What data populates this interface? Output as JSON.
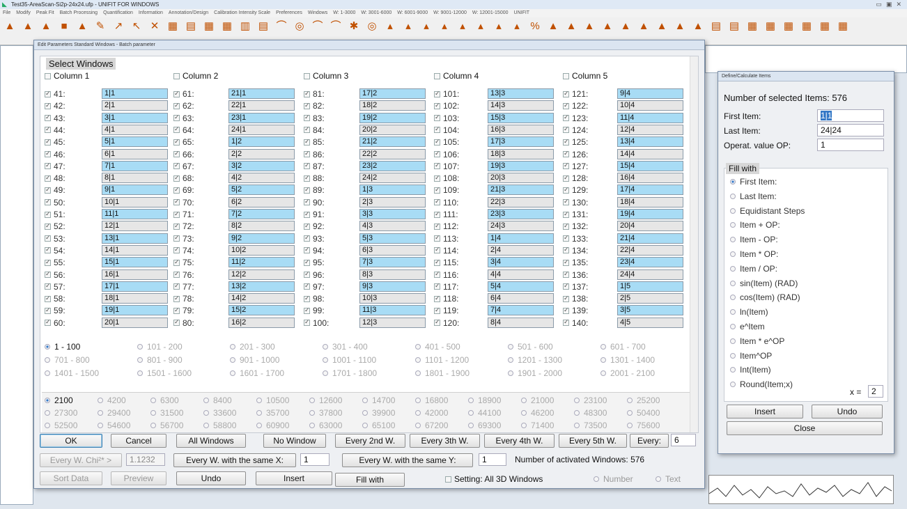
{
  "app": {
    "title": "Test35-AreaScan-Si2p-24x24.ufp - UNIFIT FOR WINDOWS",
    "menu": [
      "File",
      "Modify",
      "Peak Fit",
      "Batch Processing",
      "Quantification",
      "Information",
      "Annotation/Design",
      "Calibration Intensity Scale",
      "Preferences",
      "Windows",
      "W: 1-3000",
      "W: 3001-6000",
      "W: 6001-9000",
      "W: 9001-12000",
      "W: 12001-15000",
      "UNIFIT"
    ]
  },
  "dialog": {
    "title": "Edit Parameters Standard Windows - Batch parameter",
    "section": "Select Windows",
    "columns": [
      "Column 1",
      "Column 2",
      "Column 3",
      "Column 4",
      "Column 5"
    ],
    "rows": [
      [
        "41:",
        "1|1",
        "61:",
        "21|1",
        "81:",
        "17|2",
        "101:",
        "13|3",
        "121:",
        "9|4"
      ],
      [
        "42:",
        "2|1",
        "62:",
        "22|1",
        "82:",
        "18|2",
        "102:",
        "14|3",
        "122:",
        "10|4"
      ],
      [
        "43:",
        "3|1",
        "63:",
        "23|1",
        "83:",
        "19|2",
        "103:",
        "15|3",
        "123:",
        "11|4"
      ],
      [
        "44:",
        "4|1",
        "64:",
        "24|1",
        "84:",
        "20|2",
        "104:",
        "16|3",
        "124:",
        "12|4"
      ],
      [
        "45:",
        "5|1",
        "65:",
        "1|2",
        "85:",
        "21|2",
        "105:",
        "17|3",
        "125:",
        "13|4"
      ],
      [
        "46:",
        "6|1",
        "66:",
        "2|2",
        "86:",
        "22|2",
        "106:",
        "18|3",
        "126:",
        "14|4"
      ],
      [
        "47:",
        "7|1",
        "67:",
        "3|2",
        "87:",
        "23|2",
        "107:",
        "19|3",
        "127:",
        "15|4"
      ],
      [
        "48:",
        "8|1",
        "68:",
        "4|2",
        "88:",
        "24|2",
        "108:",
        "20|3",
        "128:",
        "16|4"
      ],
      [
        "49:",
        "9|1",
        "69:",
        "5|2",
        "89:",
        "1|3",
        "109:",
        "21|3",
        "129:",
        "17|4"
      ],
      [
        "50:",
        "10|1",
        "70:",
        "6|2",
        "90:",
        "2|3",
        "110:",
        "22|3",
        "130:",
        "18|4"
      ],
      [
        "51:",
        "11|1",
        "71:",
        "7|2",
        "91:",
        "3|3",
        "111:",
        "23|3",
        "131:",
        "19|4"
      ],
      [
        "52:",
        "12|1",
        "72:",
        "8|2",
        "92:",
        "4|3",
        "112:",
        "24|3",
        "132:",
        "20|4"
      ],
      [
        "53:",
        "13|1",
        "73:",
        "9|2",
        "93:",
        "5|3",
        "113:",
        "1|4",
        "133:",
        "21|4"
      ],
      [
        "54:",
        "14|1",
        "74:",
        "10|2",
        "94:",
        "6|3",
        "114:",
        "2|4",
        "134:",
        "22|4"
      ],
      [
        "55:",
        "15|1",
        "75:",
        "11|2",
        "95:",
        "7|3",
        "115:",
        "3|4",
        "135:",
        "23|4"
      ],
      [
        "56:",
        "16|1",
        "76:",
        "12|2",
        "96:",
        "8|3",
        "116:",
        "4|4",
        "136:",
        "24|4"
      ],
      [
        "57:",
        "17|1",
        "77:",
        "13|2",
        "97:",
        "9|3",
        "117:",
        "5|4",
        "137:",
        "1|5"
      ],
      [
        "58:",
        "18|1",
        "78:",
        "14|2",
        "98:",
        "10|3",
        "118:",
        "6|4",
        "138:",
        "2|5"
      ],
      [
        "59:",
        "19|1",
        "79:",
        "15|2",
        "99:",
        "11|3",
        "119:",
        "7|4",
        "139:",
        "3|5"
      ],
      [
        "60:",
        "20|1",
        "80:",
        "16|2",
        "100:",
        "12|3",
        "120:",
        "8|4",
        "140:",
        "4|5"
      ]
    ],
    "ranges": [
      "1 - 100",
      "101 - 200",
      "201 - 300",
      "301 - 400",
      "401 - 500",
      "501 - 600",
      "601 - 700",
      "701 - 800",
      "801 - 900",
      "901 - 1000",
      "1001 - 1100",
      "1101 - 1200",
      "1201 - 1300",
      "1301 - 1400",
      "1401 - 1500",
      "1501 - 1600",
      "1601 - 1700",
      "1701 - 1800",
      "1801 - 1900",
      "1901 - 2000",
      "2001 - 2100"
    ],
    "pages": [
      "2100",
      "4200",
      "6300",
      "8400",
      "10500",
      "12600",
      "14700",
      "16800",
      "18900",
      "21000",
      "23100",
      "25200",
      "27300",
      "29400",
      "31500",
      "33600",
      "35700",
      "37800",
      "39900",
      "42000",
      "44100",
      "46200",
      "48300",
      "50400",
      "52500",
      "54600",
      "56700",
      "58800",
      "60900",
      "63000",
      "65100",
      "67200",
      "69300",
      "71400",
      "73500",
      "75600"
    ],
    "buttons": {
      "ok": "OK",
      "cancel": "Cancel",
      "all": "All Windows",
      "none": "No Window",
      "every2": "Every 2nd W.",
      "every3": "Every 3th W.",
      "every4": "Every 4th W.",
      "every5": "Every 5th W.",
      "every": "Every:",
      "chi": "Every W. Chi²* >",
      "samex": "Every W. with the same X:",
      "samey": "Every W. with the same Y:",
      "sort": "Sort Data",
      "preview": "Preview",
      "undo": "Undo",
      "insert": "Insert",
      "fill": "Fill with"
    },
    "inputs": {
      "every": "6",
      "chi": "1.1232",
      "samex": "1",
      "samey": "1"
    },
    "activated": "Number of activated Windows: 576",
    "setting3d": "Setting: All 3D Windows",
    "number": "Number",
    "text": "Text"
  },
  "define": {
    "title": "Define/Calculate Items",
    "selected": "Number of selected Items:  576",
    "first_label": "First Item:",
    "first_value": "1|1",
    "last_label": "Last Item:",
    "last_value": "24|24",
    "op_label": "Operat. value OP:",
    "op_value": "1",
    "fill_legend": "Fill with",
    "options": [
      "First Item:",
      "Last Item:",
      "Equidistant Steps",
      "Item + OP:",
      "Item - OP:",
      "Item * OP:",
      "Item / OP:",
      "sin(Item) (RAD)",
      "cos(Item) (RAD)",
      "ln(Item)",
      "e^Item",
      "Item * e^OP",
      "Item^OP",
      "Int(Item)",
      "Round(Item;x)"
    ],
    "x_label": "x =",
    "x_value": "2",
    "insert": "Insert",
    "undo": "Undo",
    "close": "Close"
  },
  "colors": {
    "highlight": "#a8dcf5",
    "accent": "#3478c6"
  }
}
